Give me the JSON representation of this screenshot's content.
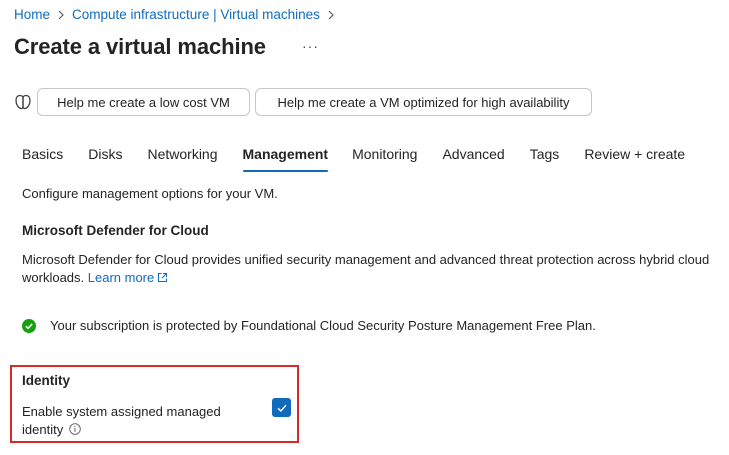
{
  "breadcrumb": [
    {
      "label": "Home"
    },
    {
      "label": "Compute infrastructure | Virtual machines"
    }
  ],
  "page": {
    "title": "Create a virtual machine",
    "more_label": "···"
  },
  "quick_actions": [
    {
      "label": "Help me create a low cost VM"
    },
    {
      "label": "Help me create a VM optimized for high availability"
    }
  ],
  "tabs": [
    {
      "label": "Basics",
      "active": false
    },
    {
      "label": "Disks",
      "active": false
    },
    {
      "label": "Networking",
      "active": false
    },
    {
      "label": "Management",
      "active": true
    },
    {
      "label": "Monitoring",
      "active": false
    },
    {
      "label": "Advanced",
      "active": false
    },
    {
      "label": "Tags",
      "active": false
    },
    {
      "label": "Review + create",
      "active": false
    }
  ],
  "management": {
    "intro": "Configure management options for your VM.",
    "defender": {
      "title": "Microsoft Defender for Cloud",
      "description": "Microsoft Defender for Cloud provides unified security management and advanced threat protection across hybrid cloud workloads.",
      "learn_more": "Learn more",
      "status": "Your subscription is protected by Foundational Cloud Security Posture Management Free Plan."
    },
    "identity": {
      "title": "Identity",
      "label": "Enable system assigned managed identity",
      "checked": true
    }
  },
  "colors": {
    "accent": "#0f6cbd",
    "success": "#13a10e",
    "highlight_border": "#d62b2b"
  },
  "icons": [
    "chevron-right-icon",
    "copilot-icon",
    "external-link-icon",
    "check-circle-icon",
    "info-icon",
    "checkmark-icon"
  ]
}
